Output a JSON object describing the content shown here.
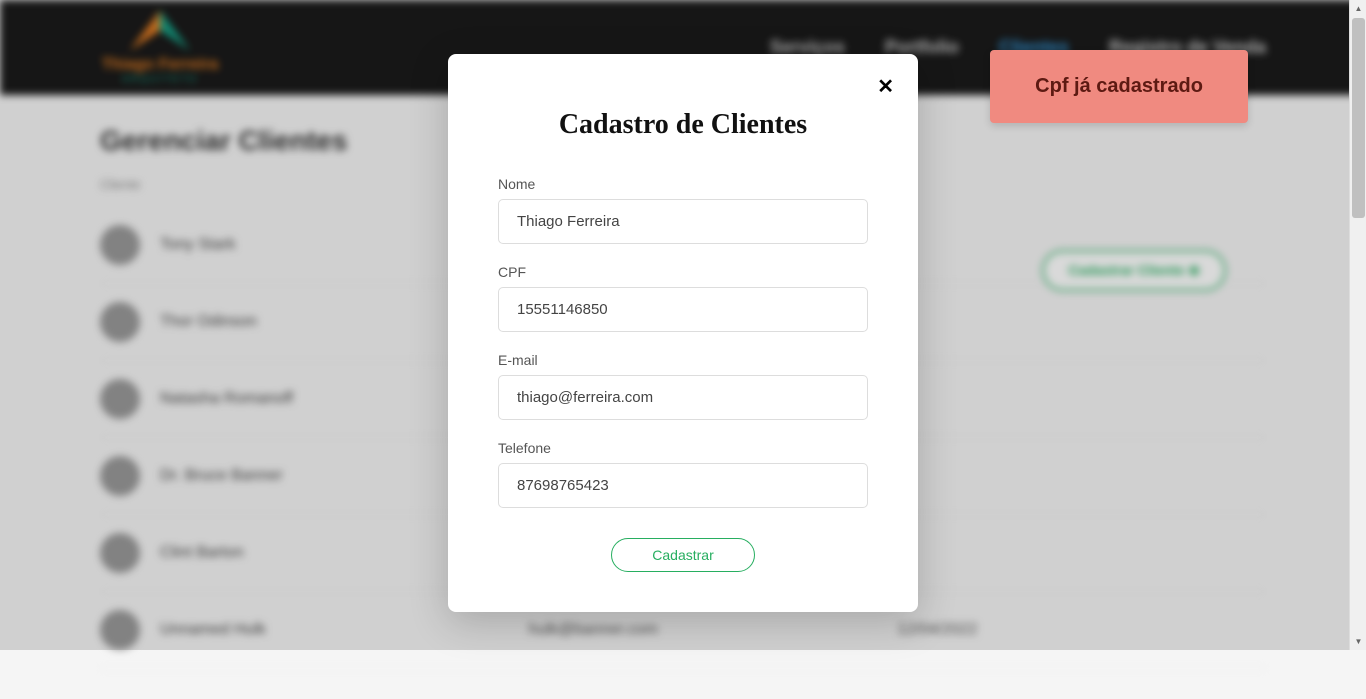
{
  "logo": {
    "text": "Thiago Ferreira",
    "subtext": "ARQUITETO"
  },
  "nav": {
    "items": [
      "Serviços",
      "Portfolio",
      "Clientes",
      "Registro de Venda"
    ]
  },
  "page": {
    "title": "Gerenciar Clientes",
    "action_button": "Cadastrar Cliente",
    "table_header": "Cliente"
  },
  "clients": [
    {
      "name": "Tony Stark",
      "email": "",
      "date": ""
    },
    {
      "name": "Thor Odinson",
      "email": "",
      "date": ""
    },
    {
      "name": "Natasha Romanoff",
      "email": "",
      "date": ""
    },
    {
      "name": "Dr. Bruce Banner",
      "email": "",
      "date": ""
    },
    {
      "name": "Clint Barton",
      "email": "",
      "date": ""
    },
    {
      "name": "Unnamed Hulk",
      "email": "hulk@banner.com",
      "date": "12/04/2022"
    }
  ],
  "modal": {
    "title": "Cadastro de Clientes",
    "fields": {
      "name": {
        "label": "Nome",
        "value": "Thiago Ferreira"
      },
      "cpf": {
        "label": "CPF",
        "value": "15551146850"
      },
      "email": {
        "label": "E-mail",
        "value": "thiago@ferreira.com"
      },
      "phone": {
        "label": "Telefone",
        "value": "87698765423"
      }
    },
    "submit": "Cadastrar",
    "close": "✕"
  },
  "toast": {
    "message": "Cpf já cadastrado"
  }
}
